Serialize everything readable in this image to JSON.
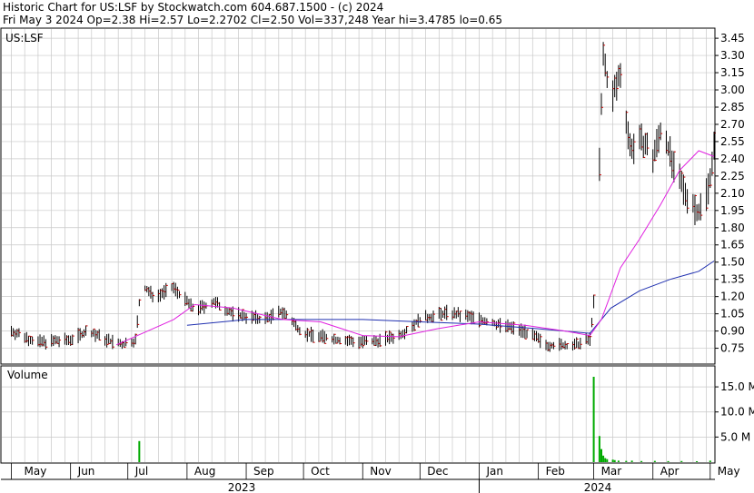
{
  "header": {
    "line1": "Historic Chart for US:LSF by Stockwatch.com 604.687.1500 - (c) 2024",
    "line2": "Fri May  3 2024   Op=2.38   Hi=2.57   Lo=2.2702   Cl=2.50   Vol=337,248   Year hi=3.4785   lo=0.65"
  },
  "colors": {
    "price_bar": "#000000",
    "close_tick": "#cc0000",
    "ma_short": "#e020e0",
    "ma_long": "#2030b0",
    "volume": "#00aa00",
    "grid": "#c8c8c8"
  },
  "chart_data": [
    {
      "type": "line",
      "title": "US:LSF",
      "series_kind": "ohlc",
      "ylim": [
        0.62,
        3.53
      ],
      "y_ticks": [
        "3.45",
        "3.30",
        "3.15",
        "3.00",
        "2.85",
        "2.70",
        "2.55",
        "2.40",
        "2.25",
        "2.10",
        "1.95",
        "1.80",
        "1.65",
        "1.50",
        "1.35",
        "1.20",
        "1.05",
        "0.90",
        "0.75"
      ],
      "x_months": [
        "May",
        "Jun",
        "Jul",
        "Aug",
        "Sep",
        "Oct",
        "Nov",
        "Dec",
        "Jan",
        "Feb",
        "Mar",
        "Apr",
        "May"
      ],
      "x_years": [
        "2023",
        "2024"
      ],
      "price_path": [
        [
          "2023-05-01",
          0.9
        ],
        [
          "2023-05-15",
          0.8
        ],
        [
          "2023-05-31",
          0.82
        ],
        [
          "2023-06-10",
          0.9
        ],
        [
          "2023-06-20",
          0.82
        ],
        [
          "2023-06-28",
          0.78
        ],
        [
          "2023-07-05",
          0.82
        ],
        [
          "2023-07-08",
          1.3
        ],
        [
          "2023-07-15",
          1.2
        ],
        [
          "2023-07-25",
          1.28
        ],
        [
          "2023-08-05",
          1.08
        ],
        [
          "2023-08-15",
          1.15
        ],
        [
          "2023-08-25",
          1.05
        ],
        [
          "2023-09-10",
          1.0
        ],
        [
          "2023-09-20",
          1.07
        ],
        [
          "2023-10-01",
          0.88
        ],
        [
          "2023-10-20",
          0.82
        ],
        [
          "2023-11-05",
          0.8
        ],
        [
          "2023-11-20",
          0.86
        ],
        [
          "2023-12-01",
          1.0
        ],
        [
          "2023-12-15",
          1.06
        ],
        [
          "2023-12-28",
          1.02
        ],
        [
          "2024-01-10",
          0.96
        ],
        [
          "2024-01-25",
          0.9
        ],
        [
          "2024-02-05",
          0.78
        ],
        [
          "2024-02-20",
          0.77
        ],
        [
          "2024-02-28",
          0.83
        ],
        [
          "2024-03-01",
          1.15
        ],
        [
          "2024-03-03",
          1.9
        ],
        [
          "2024-03-06",
          3.3
        ],
        [
          "2024-03-10",
          2.9
        ],
        [
          "2024-03-15",
          3.15
        ],
        [
          "2024-03-20",
          2.5
        ],
        [
          "2024-03-27",
          2.55
        ],
        [
          "2024-04-01",
          2.4
        ],
        [
          "2024-04-06",
          2.7
        ],
        [
          "2024-04-12",
          2.3
        ],
        [
          "2024-04-18",
          2.1
        ],
        [
          "2024-04-25",
          1.93
        ],
        [
          "2024-04-30",
          2.15
        ],
        [
          "2024-05-03",
          2.5
        ]
      ],
      "ma_short_path": [
        [
          "2023-06-25",
          0.78
        ],
        [
          "2023-07-25",
          1.0
        ],
        [
          "2023-08-05",
          1.13
        ],
        [
          "2023-08-25",
          1.1
        ],
        [
          "2023-09-20",
          1.0
        ],
        [
          "2023-10-10",
          0.98
        ],
        [
          "2023-11-01",
          0.86
        ],
        [
          "2023-11-20",
          0.85
        ],
        [
          "2023-12-10",
          0.92
        ],
        [
          "2024-01-01",
          0.98
        ],
        [
          "2024-01-25",
          0.95
        ],
        [
          "2024-02-15",
          0.9
        ],
        [
          "2024-02-28",
          0.86
        ],
        [
          "2024-03-05",
          1.0
        ],
        [
          "2024-03-15",
          1.45
        ],
        [
          "2024-03-25",
          1.7
        ],
        [
          "2024-04-05",
          2.0
        ],
        [
          "2024-04-15",
          2.3
        ],
        [
          "2024-04-25",
          2.47
        ],
        [
          "2024-05-03",
          2.42
        ]
      ],
      "ma_long_path": [
        [
          "2023-08-01",
          0.95
        ],
        [
          "2023-09-01",
          1.0
        ],
        [
          "2023-10-01",
          1.0
        ],
        [
          "2023-11-01",
          1.0
        ],
        [
          "2023-12-01",
          0.98
        ],
        [
          "2024-01-01",
          0.96
        ],
        [
          "2024-02-01",
          0.92
        ],
        [
          "2024-02-28",
          0.88
        ],
        [
          "2024-03-10",
          1.1
        ],
        [
          "2024-03-25",
          1.25
        ],
        [
          "2024-04-10",
          1.35
        ],
        [
          "2024-04-25",
          1.42
        ],
        [
          "2024-05-03",
          1.51
        ]
      ],
      "x_date_range": [
        "2023-04-26",
        "2024-05-03"
      ]
    },
    {
      "type": "bar",
      "title": "Volume",
      "ylim": [
        0,
        19
      ],
      "y_ticks": [
        "15.0 M",
        "10.0 M",
        "5.0 M"
      ],
      "unit": "millions of shares",
      "bars": [
        [
          "2023-07-07",
          4.2
        ],
        [
          "2024-03-01",
          17.0
        ],
        [
          "2024-03-04",
          5.2
        ],
        [
          "2024-03-05",
          2.6
        ],
        [
          "2024-03-06",
          1.3
        ],
        [
          "2024-03-07",
          0.8
        ],
        [
          "2024-03-08",
          0.6
        ],
        [
          "2024-03-11",
          0.5
        ],
        [
          "2024-03-12",
          0.4
        ],
        [
          "2024-03-14",
          0.3
        ],
        [
          "2024-03-18",
          0.25
        ],
        [
          "2024-03-21",
          0.3
        ],
        [
          "2024-03-26",
          0.22
        ],
        [
          "2024-04-02",
          0.25
        ],
        [
          "2024-04-09",
          0.2
        ],
        [
          "2024-04-16",
          0.22
        ],
        [
          "2024-04-24",
          0.18
        ],
        [
          "2024-05-01",
          0.3
        ]
      ]
    }
  ]
}
